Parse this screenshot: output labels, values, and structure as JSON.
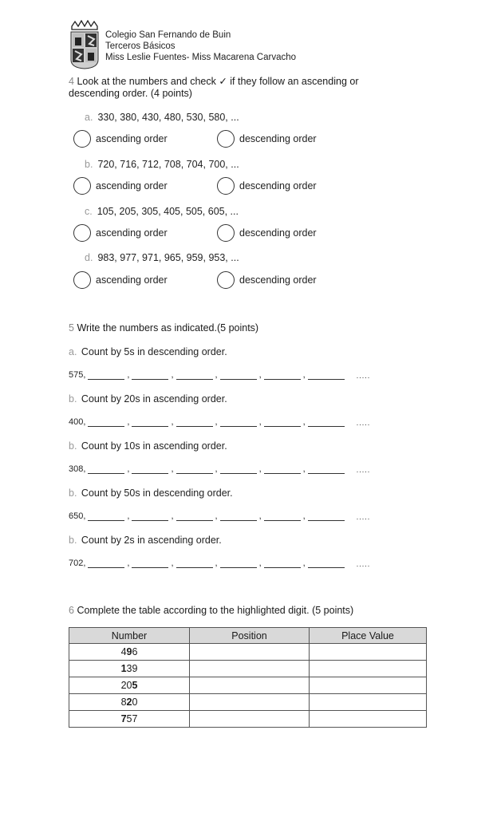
{
  "header": {
    "logo_icon": "coat-of-arms-icon",
    "lines": [
      "Colegio San Fernando de Buin",
      "Terceros Básicos",
      "Miss Leslie Fuentes- Miss Macarena Carvacho"
    ]
  },
  "q4": {
    "number": "4",
    "title_line1": "Look at the numbers and check ✓ if they follow an ascending or",
    "title_line2": "descending order. (4 points)",
    "items": [
      {
        "letter": "a.",
        "sequence": "330, 380, 430, 480, 530, 580, ...",
        "opt1": "ascending order",
        "opt2": "descending order"
      },
      {
        "letter": "b.",
        "sequence": "720, 716, 712, 708, 704, 700, ...",
        "opt1": "ascending order",
        "opt2": "descending order"
      },
      {
        "letter": "c.",
        "sequence": "105, 205, 305, 405, 505, 605,  ...",
        "opt1": "ascending order",
        "opt2": "descending order"
      },
      {
        "letter": "d.",
        "sequence": "983, 977, 971, 965, 959, 953,  ...",
        "opt1": "ascending order",
        "opt2": "descending order"
      }
    ]
  },
  "q5": {
    "number": "5",
    "title": "Write the numbers as indicated.(5 points)",
    "items": [
      {
        "letter": "a.",
        "instruction": "Count by 5s in descending order.",
        "start": "575,",
        "dots": "....."
      },
      {
        "letter": "b.",
        "instruction": "Count by 20s in ascending order.",
        "start": "400,",
        "dots": "....."
      },
      {
        "letter": "b.",
        "instruction": "Count by 10s in ascending order.",
        "start": "308,",
        "dots": "....."
      },
      {
        "letter": "b.",
        "instruction": "Count by 50s in descending order.",
        "start": "650,",
        "dots": "....."
      },
      {
        "letter": "b.",
        "instruction": "Count by 2s in ascending order.",
        "start": "702,",
        "dots": "....."
      }
    ]
  },
  "q6": {
    "number": "6",
    "title": "Complete the table according to the highlighted digit. (5 points)",
    "headers": [
      "Number",
      "Position",
      "Place Value"
    ],
    "rows": [
      {
        "pre": "4",
        "bold": "9",
        "post": "6"
      },
      {
        "pre": "",
        "bold": "1",
        "post": "39"
      },
      {
        "pre": "20",
        "bold": "5",
        "post": ""
      },
      {
        "pre": "8",
        "bold": "2",
        "post": "0"
      },
      {
        "pre": "",
        "bold": "7",
        "post": "57"
      }
    ]
  }
}
